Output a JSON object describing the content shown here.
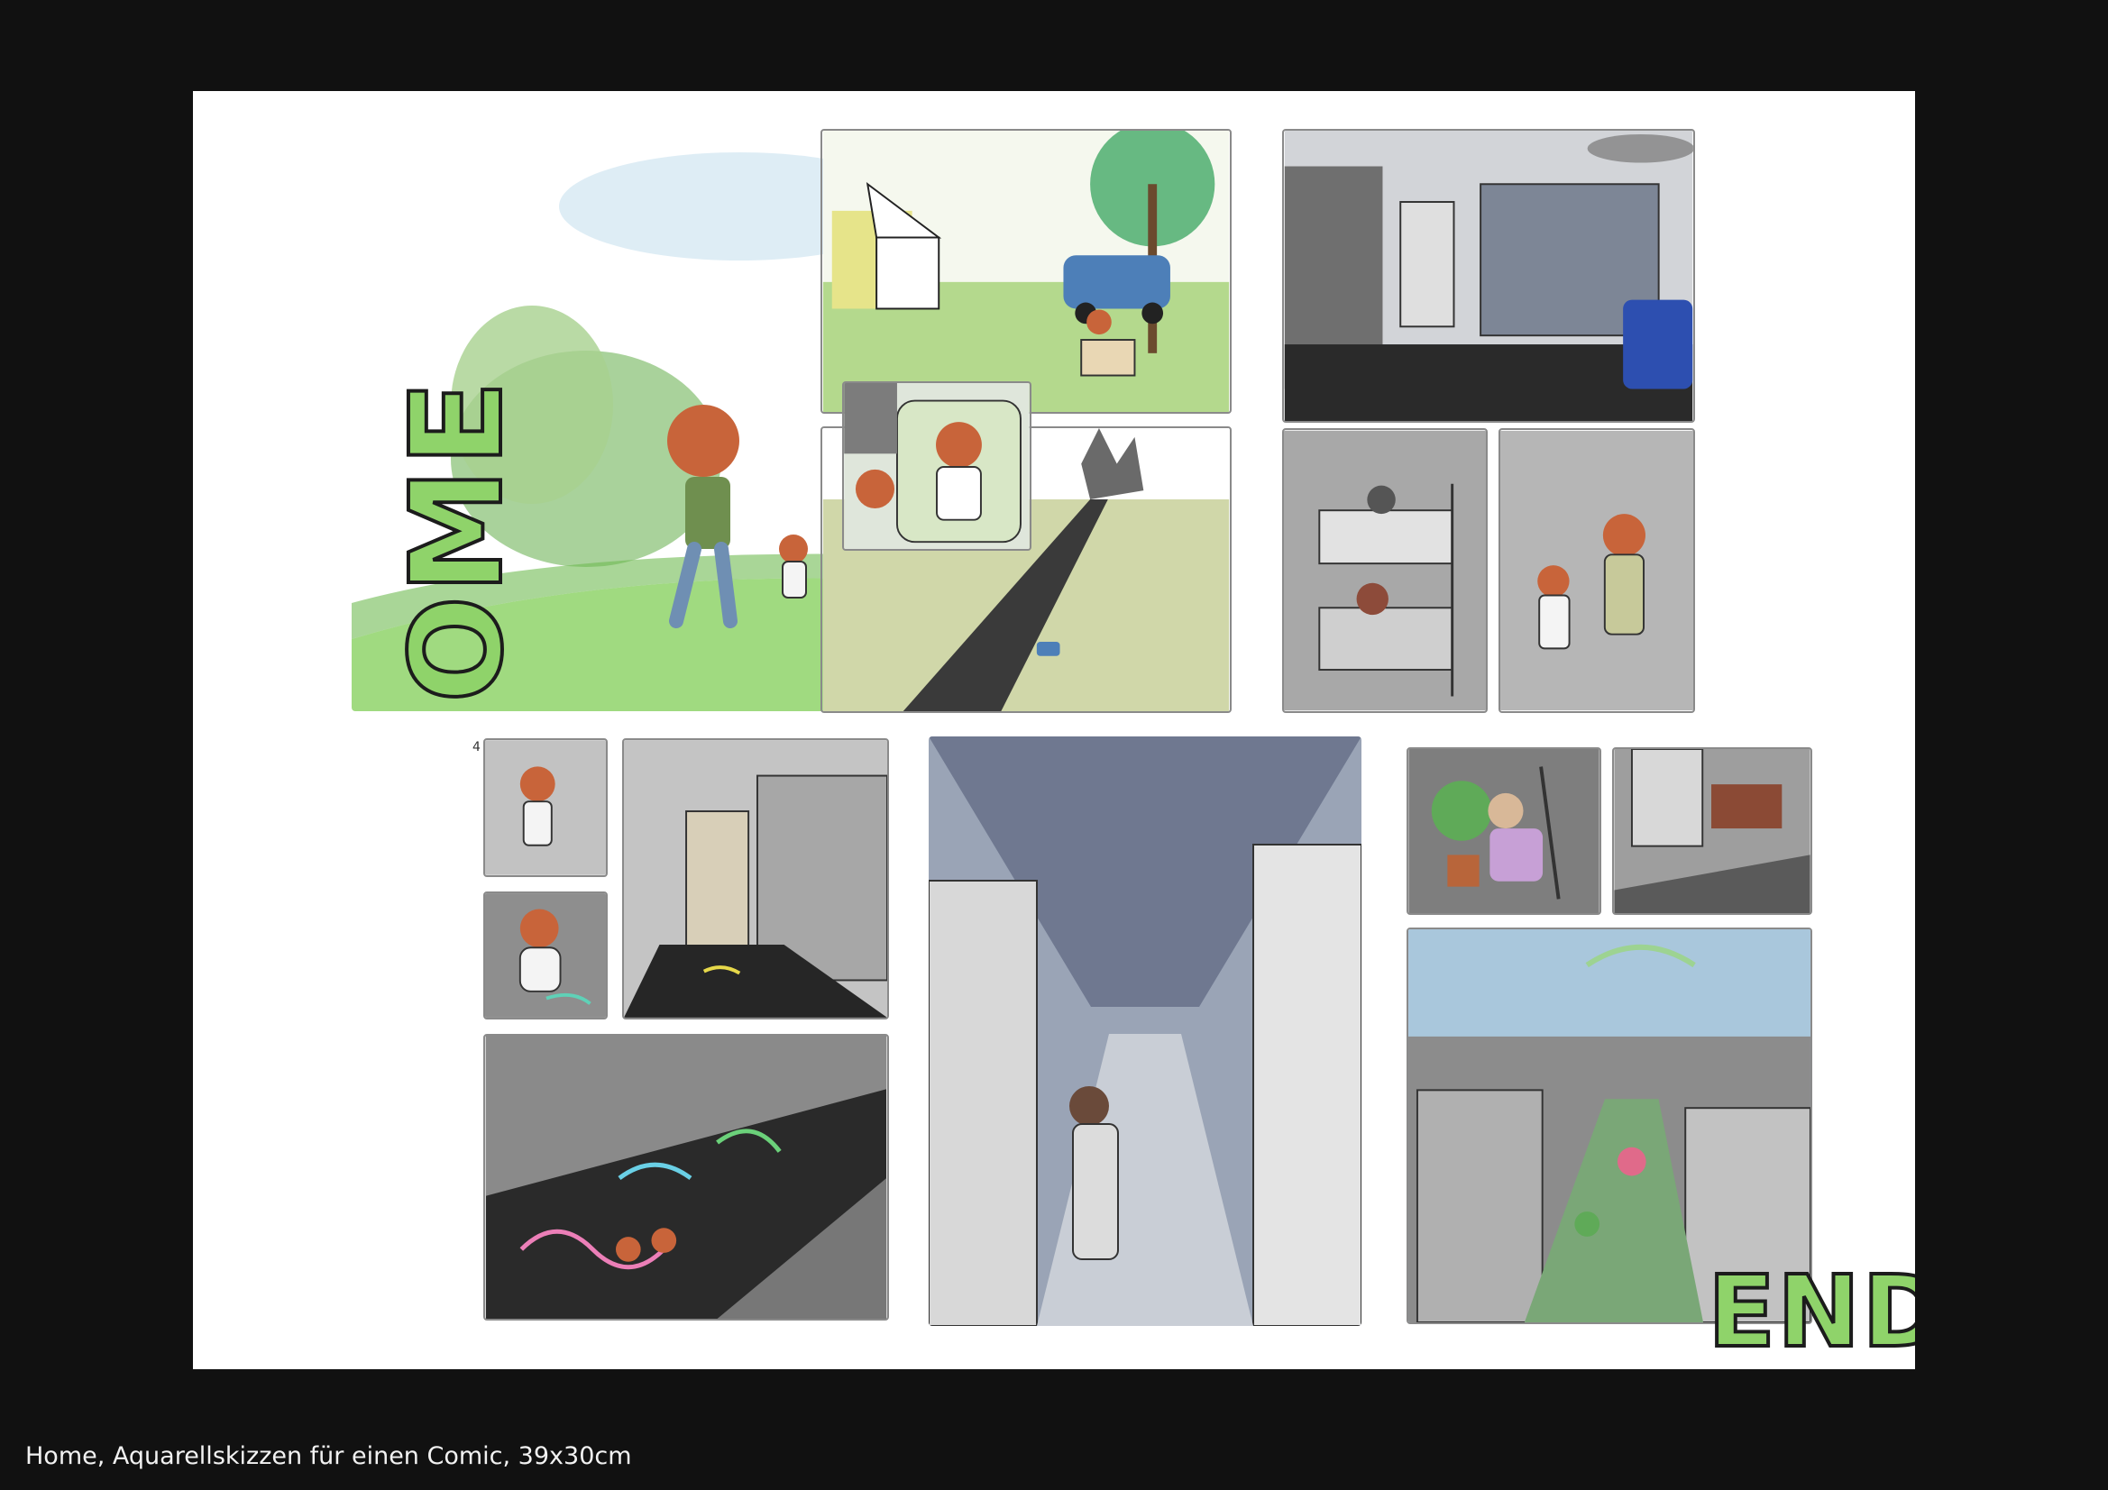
{
  "artwork": {
    "home_text": "HOME",
    "end_text": "END",
    "caption": "Home, Aquarellskizzen für einen Comic, 39x30cm",
    "page_number": "4",
    "colors": {
      "background": "#111111",
      "paper": "#ffffff",
      "grass_green": "#8fd36a",
      "city_gray": "#8c8c8c",
      "night_black": "#1a1a1a",
      "sky_blue": "#a9c7dc",
      "hair_orange": "#c8643a"
    }
  }
}
